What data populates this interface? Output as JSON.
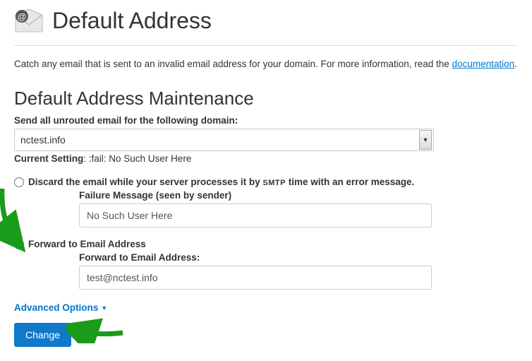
{
  "header": {
    "title": "Default Address"
  },
  "intro": {
    "text_before": "Catch any email that is sent to an invalid email address for your domain. For more information, read the ",
    "link": "documentation",
    "text_after": "."
  },
  "section_title": "Default Address Maintenance",
  "domain": {
    "label": "Send all unrouted email for the following domain:",
    "selected": "nctest.info"
  },
  "current": {
    "label": "Current Setting",
    "value": ": :fail: No Such User Here"
  },
  "options": {
    "discard": {
      "label_before": "Discard the email while your server processes it by ",
      "smtp": "SMTP",
      "label_after": " time with an error message.",
      "checked": false,
      "failure_label": "Failure Message (seen by sender)",
      "failure_value": "No Such User Here"
    },
    "forward": {
      "label": "Forward to Email Address",
      "checked": true,
      "input_label": "Forward to Email Address:",
      "input_value": "test@nctest.info"
    }
  },
  "advanced": "Advanced Options",
  "button": "Change"
}
